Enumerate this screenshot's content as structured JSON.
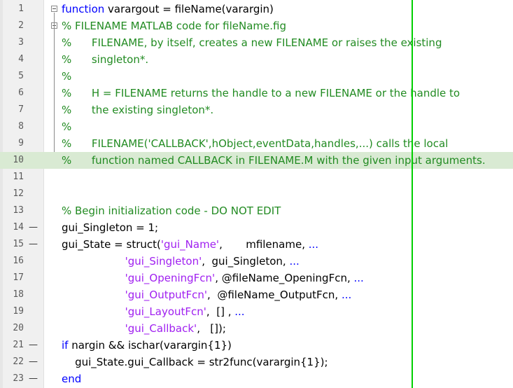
{
  "editor": {
    "highlighted_line": 10,
    "lines": [
      {
        "n": "1",
        "dash": "",
        "parts": [
          {
            "t": "function",
            "c": "kw"
          },
          {
            "t": " varargout = fileName(varargin)",
            "c": ""
          }
        ]
      },
      {
        "n": "2",
        "dash": "",
        "parts": [
          {
            "t": "% FILENAME MATLAB code for fileName.fig",
            "c": "cm"
          }
        ]
      },
      {
        "n": "3",
        "dash": "",
        "parts": [
          {
            "t": "%      FILENAME, by itself, creates a new FILENAME or raises the existing",
            "c": "cm"
          }
        ]
      },
      {
        "n": "4",
        "dash": "",
        "parts": [
          {
            "t": "%      singleton*.",
            "c": "cm"
          }
        ]
      },
      {
        "n": "5",
        "dash": "",
        "parts": [
          {
            "t": "%",
            "c": "cm"
          }
        ]
      },
      {
        "n": "6",
        "dash": "",
        "parts": [
          {
            "t": "%      H = FILENAME returns the handle to a new FILENAME or the handle to",
            "c": "cm"
          }
        ]
      },
      {
        "n": "7",
        "dash": "",
        "parts": [
          {
            "t": "%      the existing singleton*.",
            "c": "cm"
          }
        ]
      },
      {
        "n": "8",
        "dash": "",
        "parts": [
          {
            "t": "%",
            "c": "cm"
          }
        ]
      },
      {
        "n": "9",
        "dash": "",
        "parts": [
          {
            "t": "%      FILENAME('CALLBACK',hObject,eventData,handles,...) calls the local",
            "c": "cm"
          }
        ]
      },
      {
        "n": "10",
        "dash": "",
        "parts": [
          {
            "t": "%      function named CALLBACK in FILENAME.M with the given input arguments.",
            "c": "cm"
          }
        ]
      },
      {
        "n": "11",
        "dash": "",
        "parts": []
      },
      {
        "n": "12",
        "dash": "",
        "parts": []
      },
      {
        "n": "13",
        "dash": "",
        "parts": [
          {
            "t": "% Begin initialization code - DO NOT EDIT",
            "c": "cm"
          }
        ]
      },
      {
        "n": "14",
        "dash": "—",
        "parts": [
          {
            "t": "gui_Singleton = 1;",
            "c": ""
          }
        ]
      },
      {
        "n": "15",
        "dash": "—",
        "parts": [
          {
            "t": "gui_State = struct(",
            "c": ""
          },
          {
            "t": "'gui_Name'",
            "c": "str"
          },
          {
            "t": ",       mfilename, ",
            "c": ""
          },
          {
            "t": "...",
            "c": "kw"
          }
        ]
      },
      {
        "n": "16",
        "dash": "",
        "parts": [
          {
            "t": "                   ",
            "c": ""
          },
          {
            "t": "'gui_Singleton'",
            "c": "str"
          },
          {
            "t": ",  gui_Singleton, ",
            "c": ""
          },
          {
            "t": "...",
            "c": "kw"
          }
        ]
      },
      {
        "n": "17",
        "dash": "",
        "parts": [
          {
            "t": "                   ",
            "c": ""
          },
          {
            "t": "'gui_OpeningFcn'",
            "c": "str"
          },
          {
            "t": ", @fileName_OpeningFcn, ",
            "c": ""
          },
          {
            "t": "...",
            "c": "kw"
          }
        ]
      },
      {
        "n": "18",
        "dash": "",
        "parts": [
          {
            "t": "                   ",
            "c": ""
          },
          {
            "t": "'gui_OutputFcn'",
            "c": "str"
          },
          {
            "t": ",  @fileName_OutputFcn, ",
            "c": ""
          },
          {
            "t": "...",
            "c": "kw"
          }
        ]
      },
      {
        "n": "19",
        "dash": "",
        "parts": [
          {
            "t": "                   ",
            "c": ""
          },
          {
            "t": "'gui_LayoutFcn'",
            "c": "str"
          },
          {
            "t": ",  [] , ",
            "c": ""
          },
          {
            "t": "...",
            "c": "kw"
          }
        ]
      },
      {
        "n": "20",
        "dash": "",
        "parts": [
          {
            "t": "                   ",
            "c": ""
          },
          {
            "t": "'gui_Callback'",
            "c": "str"
          },
          {
            "t": ",   []);",
            "c": ""
          }
        ]
      },
      {
        "n": "21",
        "dash": "—",
        "parts": [
          {
            "t": "if",
            "c": "kw"
          },
          {
            "t": " nargin && ischar(varargin{1})",
            "c": ""
          }
        ]
      },
      {
        "n": "22",
        "dash": "—",
        "parts": [
          {
            "t": "    gui_State.gui_Callback = str2func(varargin{1});",
            "c": ""
          }
        ]
      },
      {
        "n": "23",
        "dash": "—",
        "parts": [
          {
            "t": "end",
            "c": "kw"
          }
        ]
      }
    ]
  },
  "colors": {
    "keyword": "#0000ff",
    "comment": "#228b22",
    "string": "#a020f0",
    "highlight": "#d9ead3",
    "right_margin_line": "#00d000"
  }
}
